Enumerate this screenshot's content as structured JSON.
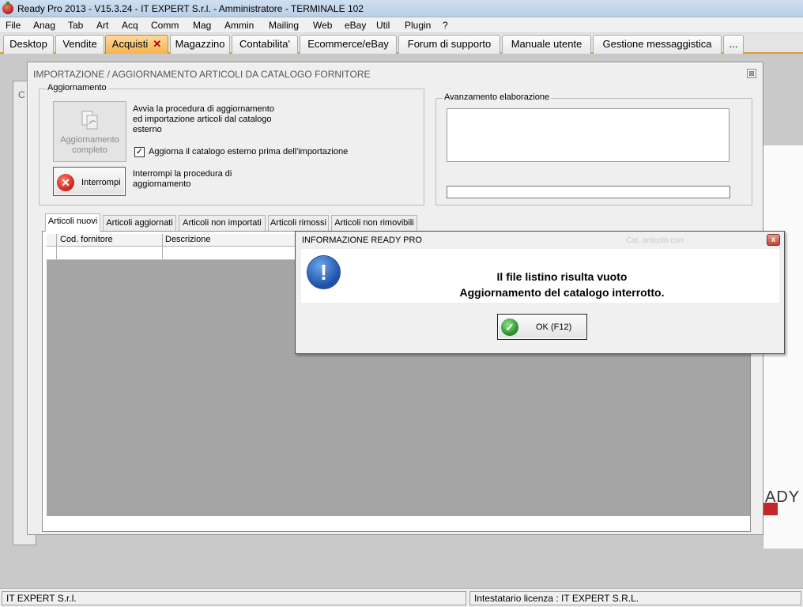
{
  "app": {
    "title": "Ready Pro 2013 - V15.3.24 - IT EXPERT S.r.l. - Amministratore - TERMINALE 102"
  },
  "menu": [
    "File",
    "Anag",
    "Tab",
    "Art",
    "Acq",
    "Comm",
    "Mag",
    "Ammin",
    "Mailing",
    "Web",
    "eBay",
    "Util",
    "Plugin",
    "?"
  ],
  "tabs": [
    {
      "label": "Desktop",
      "active": false
    },
    {
      "label": "Vendite",
      "active": false
    },
    {
      "label": "Acquisti",
      "active": true,
      "close": "✕"
    },
    {
      "label": "Magazzino",
      "active": false
    },
    {
      "label": "Contabilita'",
      "active": false
    },
    {
      "label": "Ecommerce/eBay",
      "active": false
    },
    {
      "label": "Forum di supporto",
      "active": false
    },
    {
      "label": "Manuale utente",
      "active": false
    },
    {
      "label": "Gestione messaggistica",
      "active": false
    },
    {
      "label": "...",
      "active": false
    }
  ],
  "background": {
    "window_initial": "C",
    "logo_text": "ADY"
  },
  "dialog": {
    "title": "IMPORTAZIONE / AGGIORNAMENTO ARTICOLI DA CATALOGO FORNITORE",
    "close": "⊠",
    "update_group_label": "Aggiornamento",
    "full_update_button_line1": "Aggiornamento",
    "full_update_button_line2": "completo",
    "full_update_desc1": "Avvia la procedura di aggiornamento",
    "full_update_desc2": "ed importazione articoli dal catalogo",
    "full_update_desc3": "esterno",
    "update_external_checkbox_label": "Aggiorna il catalogo esterno prima dell'importazione",
    "update_external_checked": true,
    "stop_button_label": "Interrompi",
    "stop_desc1": "Interrompi la procedura di",
    "stop_desc2": "aggiornamento",
    "progress_group_label": "Avanzamento elaborazione",
    "progress_value": 0,
    "inner_tabs": [
      {
        "label": "Articoli nuovi",
        "active": true
      },
      {
        "label": "Articoli aggiornati",
        "active": false
      },
      {
        "label": "Articoli non importati",
        "active": false
      },
      {
        "label": "Articoli rimossi",
        "active": false
      },
      {
        "label": "Articoli non rimovibili",
        "active": false
      }
    ],
    "grid_columns": [
      "Cod. fornitore",
      "Descrizione"
    ]
  },
  "message_box": {
    "title": "INFORMAZIONE READY PRO",
    "ghost_text": "Cat. articolo corr.",
    "close": "x",
    "line1": "Il file listino risulta vuoto",
    "line2": "Aggiornamento del catalogo interrotto.",
    "ok_label": "OK (F12)",
    "icon_glyph": "!"
  },
  "status": {
    "left": "IT EXPERT S.r.l.",
    "right": "Intestatario licenza : IT EXPERT S.R.L."
  },
  "colors": {
    "active_tab": "#f5b54f",
    "info_icon": "#1b4fa8",
    "close_red": "#c0432f"
  }
}
